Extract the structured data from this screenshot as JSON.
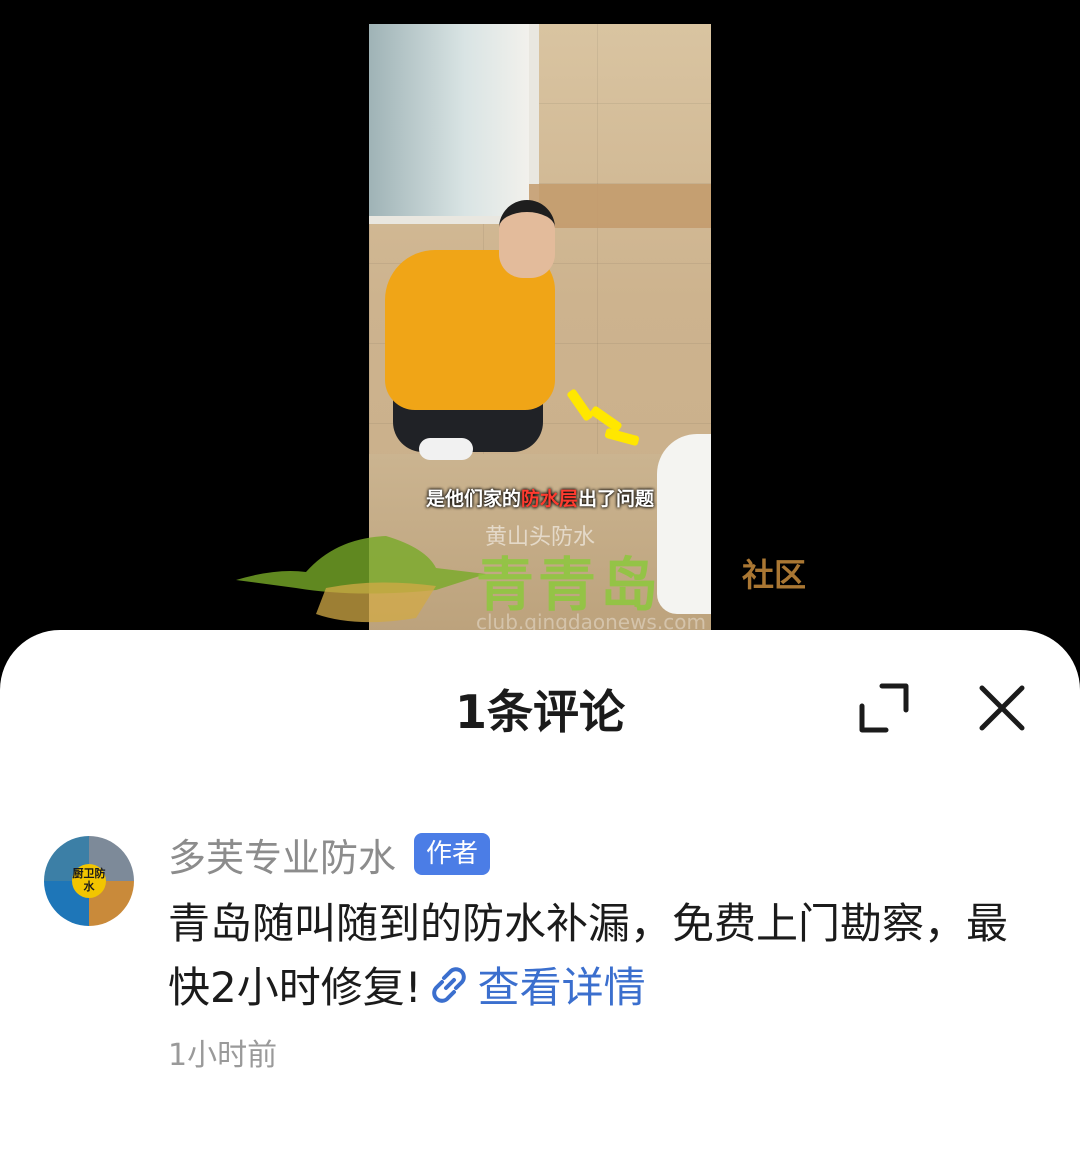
{
  "video": {
    "subtitle_before": "是他们家的",
    "subtitle_highlight": "防水层",
    "subtitle_after": "出了问题",
    "watermark_text": "黄山头防水"
  },
  "site_watermark": {
    "logo_text": "青青岛",
    "community": "社区",
    "url": "club.qingdaonews.com"
  },
  "sheet": {
    "title": "1条评论",
    "expand_icon": "expand-icon",
    "close_icon": "close-icon"
  },
  "comment": {
    "avatar_label": "厨卫防水",
    "author": "多芙专业防水",
    "tag": "作者",
    "text": "青岛随叫随到的防水补漏，免费上门勘察，最快2小时修复!",
    "link_icon": "link-icon",
    "link_text": "查看详情",
    "time": "1小时前"
  },
  "colors": {
    "link": "#3b6fce",
    "tag_bg": "#4b7de6",
    "highlight": "#ff3b2f"
  }
}
